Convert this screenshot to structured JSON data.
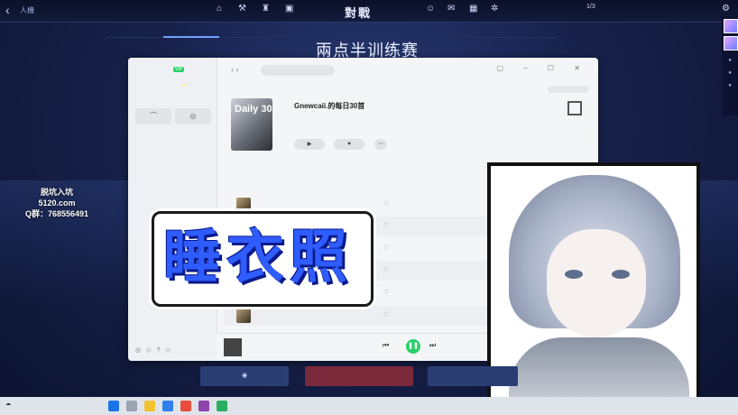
{
  "game": {
    "back_icon": "chevron-left-icon",
    "breadcrumb": "人機",
    "title": "對戰",
    "subtabs": [
      "",
      "",
      "",
      "",
      "",
      "",
      "",
      ""
    ],
    "room_title": "兩点半训练赛",
    "right_status": "1/3"
  },
  "promo": {
    "line1": "脱坑入坑",
    "line2": "5120.com",
    "line3": "Q群：768556491"
  },
  "music": {
    "search_placeholder": "",
    "sidebar_user": "",
    "sidebar_vip": "VIP",
    "sidebar_items": [
      "",
      "",
      "",
      ""
    ],
    "cover_text": "Daily 30",
    "playlist_title": "Gnewcaii.的每日30首",
    "tab_songs": "",
    "header_index": "",
    "header_album": "",
    "songs": [
      {
        "name": ""
      },
      {
        "name": ""
      },
      {
        "name": ""
      },
      {
        "name": ""
      },
      {
        "name": ""
      },
      {
        "name": ""
      }
    ],
    "player_title": ""
  },
  "overlay": {
    "big_text": "睡衣照"
  },
  "colors": {
    "accent_green": "#2bd06a",
    "label_blue": "#2f5cff"
  }
}
